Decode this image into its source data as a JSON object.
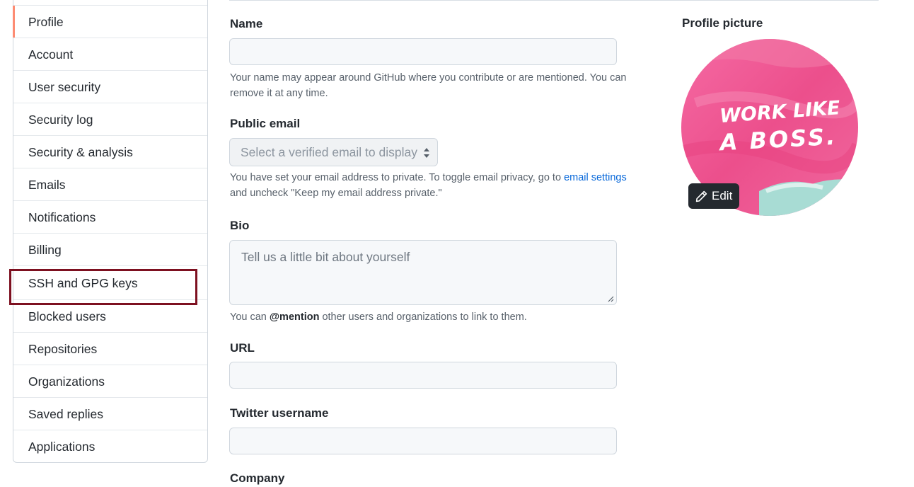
{
  "sidebar": {
    "items": [
      {
        "label": "Profile"
      },
      {
        "label": "Account"
      },
      {
        "label": "User security"
      },
      {
        "label": "Security log"
      },
      {
        "label": "Security & analysis"
      },
      {
        "label": "Emails"
      },
      {
        "label": "Notifications"
      },
      {
        "label": "Billing"
      },
      {
        "label": "SSH and GPG keys"
      },
      {
        "label": "Blocked users"
      },
      {
        "label": "Repositories"
      },
      {
        "label": "Organizations"
      },
      {
        "label": "Saved replies"
      },
      {
        "label": "Applications"
      }
    ],
    "selected": "Profile",
    "highlighted": "SSH and GPG keys"
  },
  "form": {
    "name_label": "Name",
    "name_value": "",
    "name_note": "Your name may appear around GitHub where you contribute or are mentioned. You can remove it at any time.",
    "email_label": "Public email",
    "email_select": "Select a verified email to display",
    "email_note_pre": "You have set your email address to private. To toggle email privacy, go to ",
    "email_note_link": "email settings",
    "email_note_post": "and uncheck \"Keep my email address private.\"",
    "bio_label": "Bio",
    "bio_placeholder": "Tell us a little bit about yourself",
    "bio_note_pre": "You can ",
    "bio_note_mention": "@mention",
    "bio_note_post": " other users and organizations to link to them.",
    "url_label": "URL",
    "url_value": "",
    "twitter_label": "Twitter username",
    "twitter_value": "",
    "company_label": "Company"
  },
  "profile_picture": {
    "label": "Profile picture",
    "image_text_line1": "WORK LIKE",
    "image_text_line2": "A BOSS.",
    "edit_label": "Edit"
  },
  "colors": {
    "selected_accent": "#fd8c73",
    "highlight_border": "#7d1020",
    "link": "#0969da",
    "avatar_pink": "#ec4f8c",
    "avatar_teal": "#a8dcd4"
  }
}
